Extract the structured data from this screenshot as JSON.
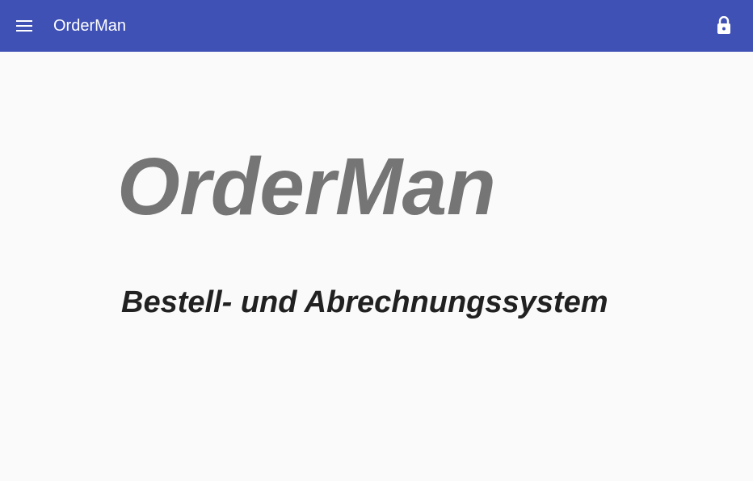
{
  "toolbar": {
    "menu_icon": "menu-icon",
    "title": "OrderMan",
    "lock_icon": "lock-icon",
    "background_color": "#3f51b5",
    "text_color": "#ffffff"
  },
  "main": {
    "title": "OrderMan",
    "subtitle": "Bestell- und Abrechnungssystem",
    "title_color": "#757575",
    "subtitle_color": "#212121"
  }
}
